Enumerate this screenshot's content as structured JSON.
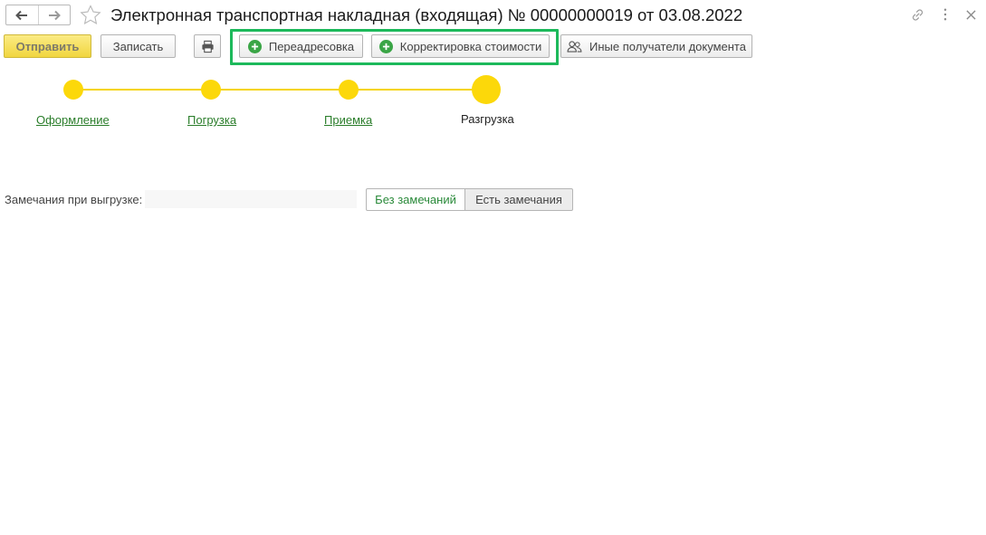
{
  "window": {
    "title": "Электронная транспортная накладная (входящая) № 00000000019 от 03.08.2022",
    "icons": [
      "arrow-left-icon",
      "arrow-right-icon",
      "star-icon",
      "link-icon",
      "more-vertical-icon",
      "close-icon"
    ]
  },
  "toolbar": {
    "send_label": "Отправить",
    "save_label": "Записать",
    "readdress_label": "Переадресовка",
    "cost_correction_label": "Корректировка стоимости",
    "other_recipients_label": "Иные получатели документа"
  },
  "steps": [
    {
      "label": "Оформление",
      "state": "done"
    },
    {
      "label": "Погрузка",
      "state": "done"
    },
    {
      "label": "Приемка",
      "state": "done"
    },
    {
      "label": "Разгрузка",
      "state": "current"
    }
  ],
  "remarks": {
    "label": "Замечания при выгрузке:",
    "value": "",
    "options": [
      "Без замечаний",
      "Есть замечания"
    ],
    "selected": "Без замечаний"
  },
  "colors": {
    "accent_yellow": "#fcd80a",
    "link_green": "#2a7d2a",
    "highlight_green": "#1db95b",
    "plus_green": "#3aa546"
  }
}
